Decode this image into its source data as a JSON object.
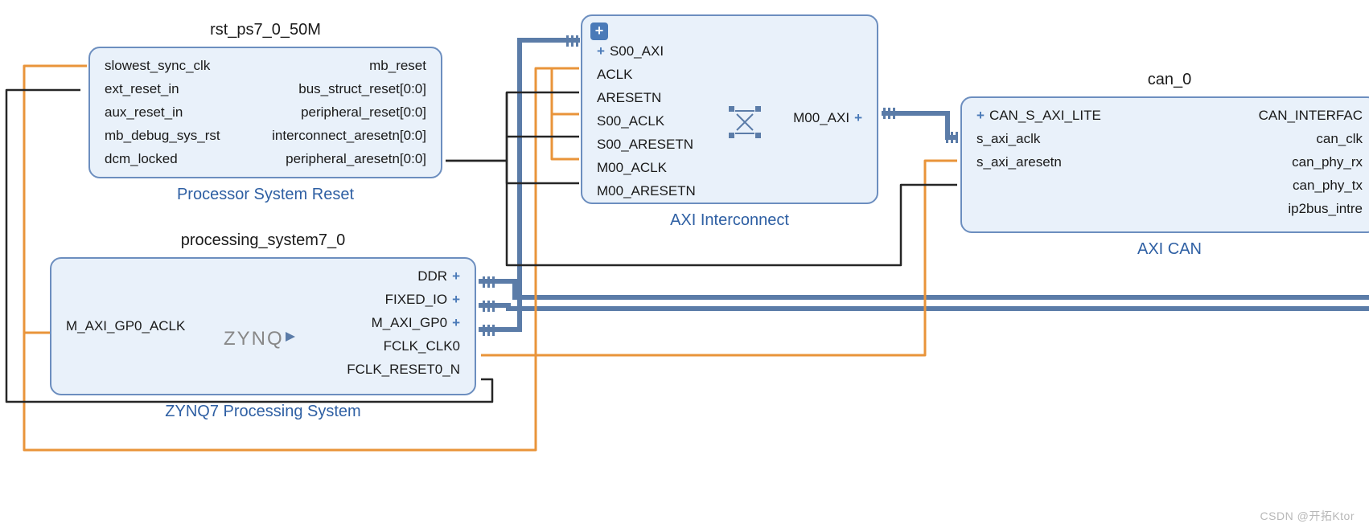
{
  "watermark": "CSDN @开拓Ktor",
  "blocks": {
    "rst": {
      "inst": "rst_ps7_0_50M",
      "type": "Processor System Reset",
      "left": [
        "slowest_sync_clk",
        "ext_reset_in",
        "aux_reset_in",
        "mb_debug_sys_rst",
        "dcm_locked"
      ],
      "right": [
        "mb_reset",
        "bus_struct_reset[0:0]",
        "peripheral_reset[0:0]",
        "interconnect_aresetn[0:0]",
        "peripheral_aresetn[0:0]"
      ]
    },
    "ps7": {
      "inst": "processing_system7_0",
      "type": "ZYNQ7 Processing System",
      "logo": "ZYNQ",
      "left": [
        "M_AXI_GP0_ACLK"
      ],
      "right": [
        "DDR",
        "FIXED_IO",
        "M_AXI_GP0",
        "FCLK_CLK0",
        "FCLK_RESET0_N"
      ]
    },
    "axi": {
      "inst": "",
      "type": "AXI Interconnect",
      "expand": "+",
      "left": [
        "S00_AXI",
        "ACLK",
        "ARESETN",
        "S00_ACLK",
        "S00_ARESETN",
        "M00_ACLK",
        "M00_ARESETN"
      ],
      "right": [
        "M00_AXI"
      ]
    },
    "can": {
      "inst": "can_0",
      "type": "AXI CAN",
      "left": [
        "CAN_S_AXI_LITE",
        "s_axi_aclk",
        "s_axi_aresetn"
      ],
      "right": [
        "CAN_INTERFAC",
        "can_clk",
        "can_phy_rx",
        "can_phy_tx",
        "ip2bus_intre"
      ]
    }
  },
  "colors": {
    "wire_blue": "#5b7ca8",
    "wire_orange": "#e9943a",
    "wire_black": "#262626",
    "block_link": "#2e5fa3"
  }
}
